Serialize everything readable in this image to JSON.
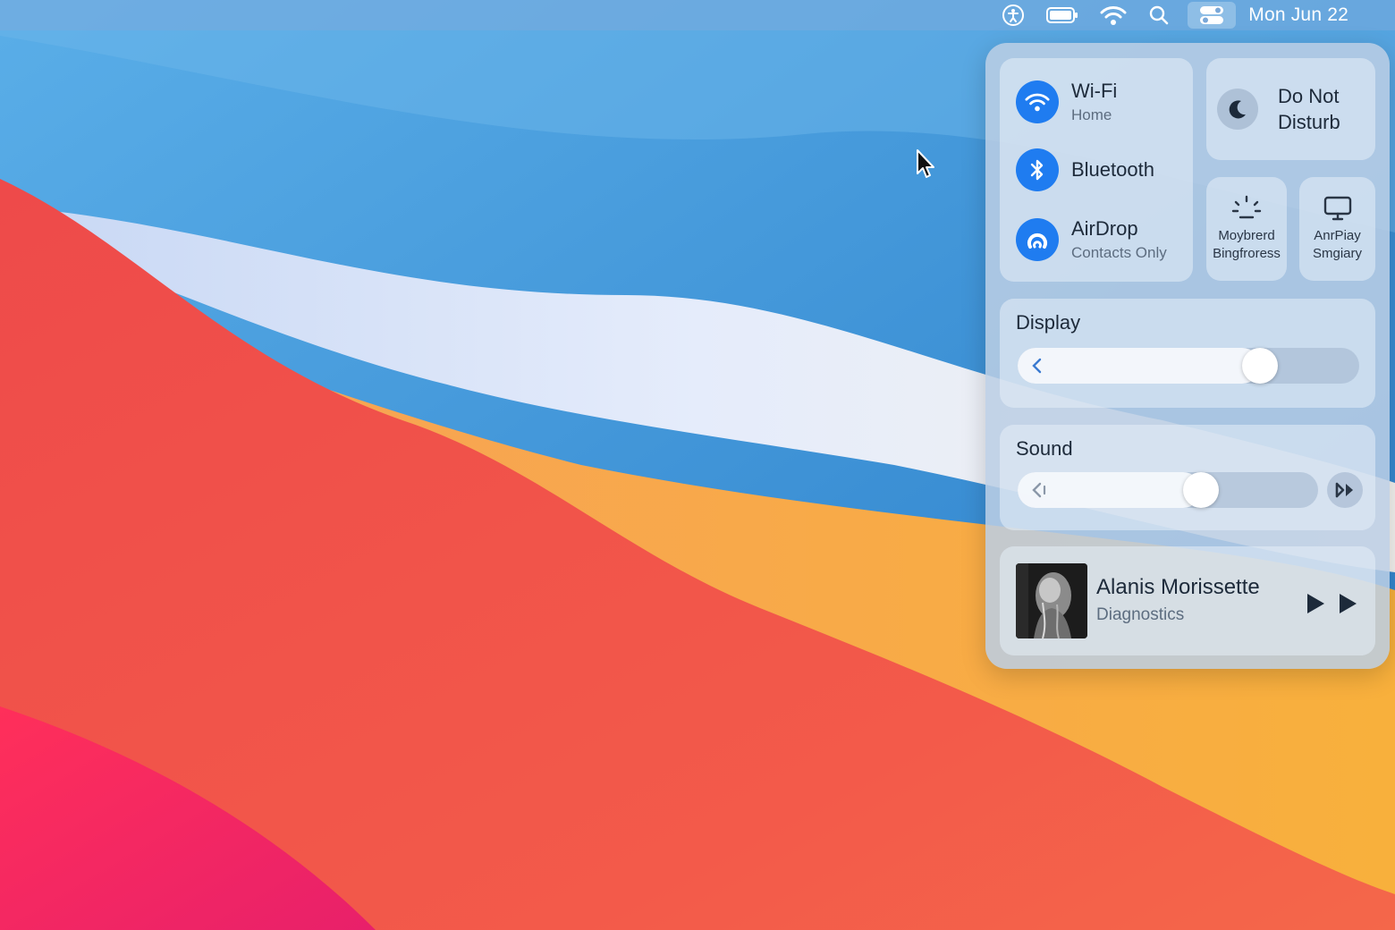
{
  "menubar": {
    "icons": [
      "accessibility-icon",
      "battery-icon",
      "wifi-icon",
      "search-icon",
      "control-center-icon"
    ],
    "clock": "Mon Jun 22"
  },
  "control_center": {
    "wifi": {
      "title": "Wi-Fi",
      "subtitle": "Home",
      "icon": "wifi-icon"
    },
    "bluetooth": {
      "title": "Bluetooth",
      "icon": "bluetooth-icon"
    },
    "airdrop": {
      "title": "AirDrop",
      "subtitle": "Contacts Only",
      "icon": "airdrop-icon"
    },
    "do_not_disturb": {
      "line1": "Do Not",
      "line2": "Disturb",
      "icon": "moon-icon"
    },
    "keyboard_brightness": {
      "line1": "Moybrerd",
      "line2": "Bingfroress",
      "icon": "keyboard-brightness-icon"
    },
    "airplay_display": {
      "line1": "AnrPiay",
      "line2": "Smgiary",
      "icon": "display-icon"
    },
    "display": {
      "title": "Display",
      "level": 0.71
    },
    "sound": {
      "title": "Sound",
      "level": 0.61
    },
    "now_playing": {
      "artist": "Alanis Morissette",
      "song": "Diagnostics"
    }
  },
  "colors": {
    "accent": "#1f7cf0",
    "panel": "#bccee4",
    "wallpaper_blue": "#3a8ed6",
    "wallpaper_red": "#f04a4a",
    "wallpaper_orange": "#f6a53a"
  }
}
